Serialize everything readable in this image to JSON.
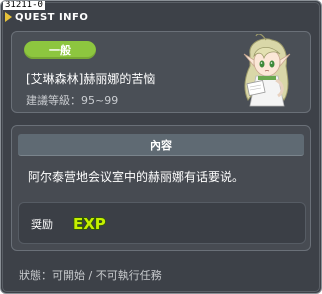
{
  "window": {
    "quest_id": "31211-0",
    "title": "QUEST INFO"
  },
  "header": {
    "badge_label": "一般",
    "quest_name": "[艾琳森林]赫丽娜的苦恼",
    "level_range": "建議等級：95~99",
    "npc_icon": "npc-portrait-icon"
  },
  "content": {
    "section_title": "內容",
    "description": "阿尔泰营地会议室中的赫丽娜有话要说。"
  },
  "reward": {
    "label": "奨励",
    "exp_text": "EXP"
  },
  "status": {
    "text": "狀態：可開始 / 不可執行任務"
  },
  "colors": {
    "badge": "#8dc63f",
    "exp_fill": "#c6f000",
    "title_arrow": "#e6c23a"
  }
}
